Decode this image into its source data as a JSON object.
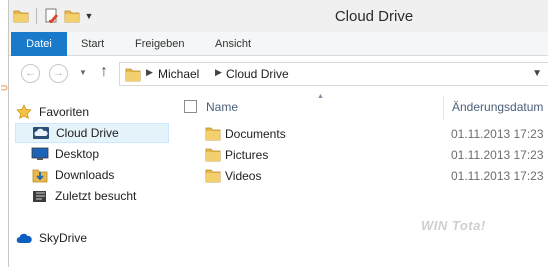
{
  "window": {
    "title": "Cloud Drive"
  },
  "quick_access": {
    "items": [
      {
        "icon": "folder-icon"
      },
      {
        "icon": "properties-icon"
      },
      {
        "icon": "new-folder-icon"
      },
      {
        "icon": "customize-dropdown-icon"
      }
    ]
  },
  "ribbon": {
    "tabs": [
      {
        "label": "Datei",
        "active": true
      },
      {
        "label": "Start"
      },
      {
        "label": "Freigeben"
      },
      {
        "label": "Ansicht"
      }
    ]
  },
  "navigation": {
    "path": [
      "Michael",
      "Cloud Drive"
    ]
  },
  "navpane": {
    "favorites_label": "Favoriten",
    "items": [
      {
        "label": "Cloud Drive",
        "icon": "cloud-drive-icon",
        "selected": true
      },
      {
        "label": "Desktop",
        "icon": "desktop-icon"
      },
      {
        "label": "Downloads",
        "icon": "downloads-icon"
      },
      {
        "label": "Zuletzt besucht",
        "icon": "recent-places-icon"
      }
    ],
    "skydrive_label": "SkyDrive"
  },
  "content": {
    "columns": {
      "name": "Name",
      "modified": "Änderungsdatum"
    },
    "rows": [
      {
        "name": "Documents",
        "date": "01.11.2013 17:23"
      },
      {
        "name": "Pictures",
        "date": "01.11.2013 17:23"
      },
      {
        "name": "Videos",
        "date": "01.11.2013 17:23"
      }
    ]
  },
  "watermark": {
    "text": "WIN Tota!"
  },
  "colors": {
    "accent": "#1979ca",
    "folder": "#e8b94a",
    "selection": "#e5f3fb",
    "header_text": "#4c607a"
  }
}
